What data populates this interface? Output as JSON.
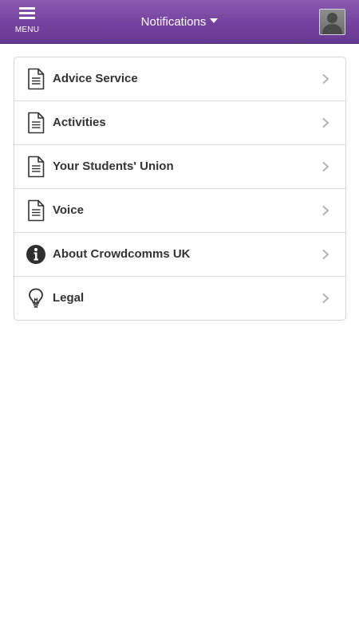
{
  "header": {
    "menu_label": "MENU",
    "notifications_label": "Notifications",
    "menu_icon": "hamburger-menu-icon",
    "dropdown_icon": "caret-down-icon",
    "avatar_icon": "user-avatar-icon",
    "background_color": "#74429e"
  },
  "list": {
    "items": [
      {
        "label": "Advice Service",
        "icon": "document-icon"
      },
      {
        "label": "Activities",
        "icon": "document-icon"
      },
      {
        "label": "Your Students' Union",
        "icon": "document-icon"
      },
      {
        "label": "Voice",
        "icon": "document-icon"
      },
      {
        "label": "About Crowdcomms UK",
        "icon": "info-icon"
      },
      {
        "label": "Legal",
        "icon": "lightbulb-icon"
      }
    ],
    "chevron_icon": "chevron-right-icon"
  }
}
